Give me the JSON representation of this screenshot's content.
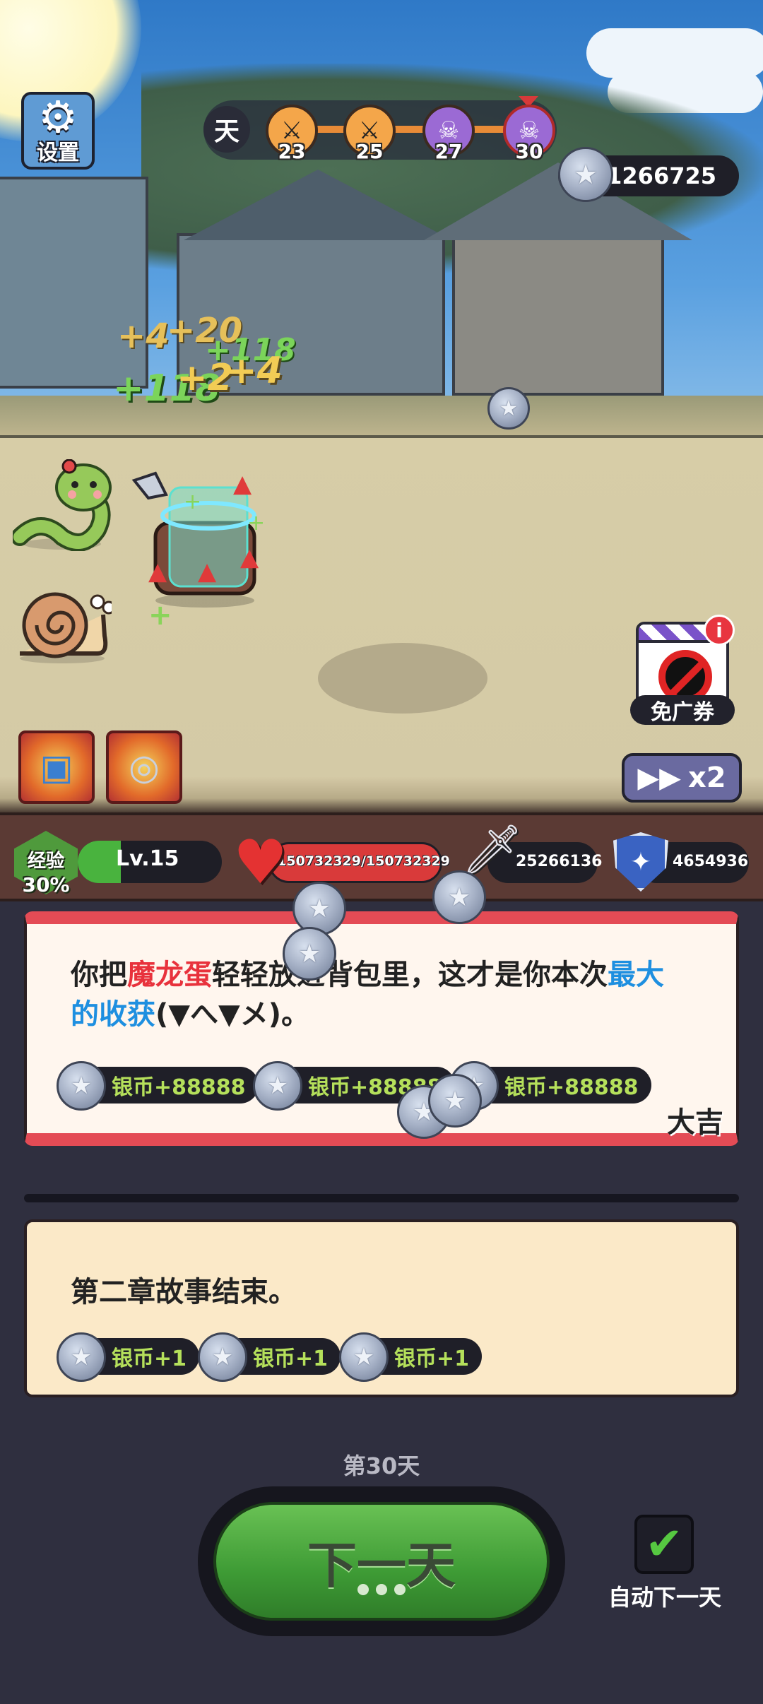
{
  "settings": {
    "label": "设置",
    "icon": "gear-icon"
  },
  "day_progress": {
    "day_label": "天",
    "nodes": [
      {
        "day": "23",
        "type": "swords"
      },
      {
        "day": "25",
        "type": "swords"
      },
      {
        "day": "27",
        "type": "skull"
      },
      {
        "day": "30",
        "type": "skull-boss"
      }
    ]
  },
  "currency": {
    "silver_total": "1266725",
    "icon": "silver-coin-icon"
  },
  "floating_numbers": {
    "gold_1": "+4",
    "gold_2": "+20",
    "gold_3": "+2",
    "gold_4": "+4",
    "green_1": "+118",
    "green_2": "+118"
  },
  "no_ad": {
    "label": "免广券",
    "badge": "i"
  },
  "speed": {
    "label": "x2"
  },
  "stats": {
    "exp_label": "经验",
    "exp_percent": "30%",
    "exp_fraction": 0.3,
    "level": "Lv.15",
    "hp": "150732329/150732329",
    "attack": "25266136",
    "defense": "4654936"
  },
  "event_card": {
    "text_part1": "你把",
    "text_red": "魔龙蛋",
    "text_part2": "轻轻放进背包里，这才是你本次",
    "text_blue1": "最大",
    "text_blue2": "的收获",
    "text_part3": "(▼へ▼メ)。",
    "rewards": [
      "银币+88888",
      "银币+88888",
      "银币+88888"
    ],
    "luck": "大吉"
  },
  "story_card": {
    "text": "第二章故事结束。",
    "rewards": [
      "银币+1",
      "银币+1",
      "银币+1"
    ]
  },
  "current_day": "第30天",
  "next_button": {
    "label": "下一天"
  },
  "auto_next": {
    "label": "自动下一天",
    "checked": true
  },
  "colors": {
    "hp": "#d93a3a",
    "exp": "#49b33e",
    "reward_text": "#b5e05b",
    "accent_red": "#e8323c",
    "accent_blue": "#1e8fe0"
  }
}
